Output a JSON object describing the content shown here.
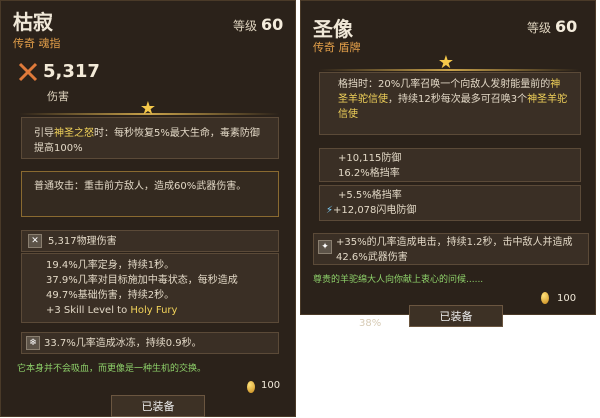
{
  "left_card": {
    "title": "枯寂",
    "subtitle": "传奇 魂指",
    "level_label": "等级",
    "level_value": "60",
    "damage_value": "5,317",
    "damage_label": "伤害",
    "legendary_pre": "引导",
    "legendary_name": "神圣之怒",
    "legendary_post": "时：每秒恢复5%最大生命，毒素防御提高100%",
    "basic_attack_text": "普通攻击：重击前方敌人，造成60%武器伤害。",
    "phys_damage": "5,317物理伤害",
    "stat_line_1": "19.4%几率定身，持续1秒。",
    "stat_line_2": "37.9%几率对目标施加中毒状态，每秒造成49.7%基础伤害，持续2秒。",
    "skill_prefix": "+3 Skill Level to ",
    "skill_name": "Holy Fury",
    "freeze_text": "33.7%几率造成冰冻，持续0.9秒。",
    "flavor": "它本身并不会吸血，而更像是一种生机的交换。",
    "price": "100",
    "equipped_button": "已装备"
  },
  "right_card": {
    "title": "圣像",
    "subtitle": "传奇 盾牌",
    "level_label": "等级",
    "level_value": "60",
    "block_pre": "格挡时：20%几率召唤一个向敌人发射能量前的",
    "block_gold_1": "神圣羊驼信使",
    "block_mid": "，持续12秒每次最多可召唤3个",
    "block_gold_2": "神圣羊驼信使",
    "defense_line_1": "+10,115防御",
    "defense_line_2": "16.2%格挡率",
    "defense_line_3": "+5.5%格挡率",
    "defense_line_4": "+12,078闪电防御",
    "shock_text": "+35%的几率造成电击，持续1.2秒，击中敌人并造成42.6%武器伤害",
    "flavor": "尊贵的羊驼绵大人向你献上衷心的问候......",
    "price": "100",
    "percent_label": "38%",
    "equipped_button": "已装备"
  }
}
